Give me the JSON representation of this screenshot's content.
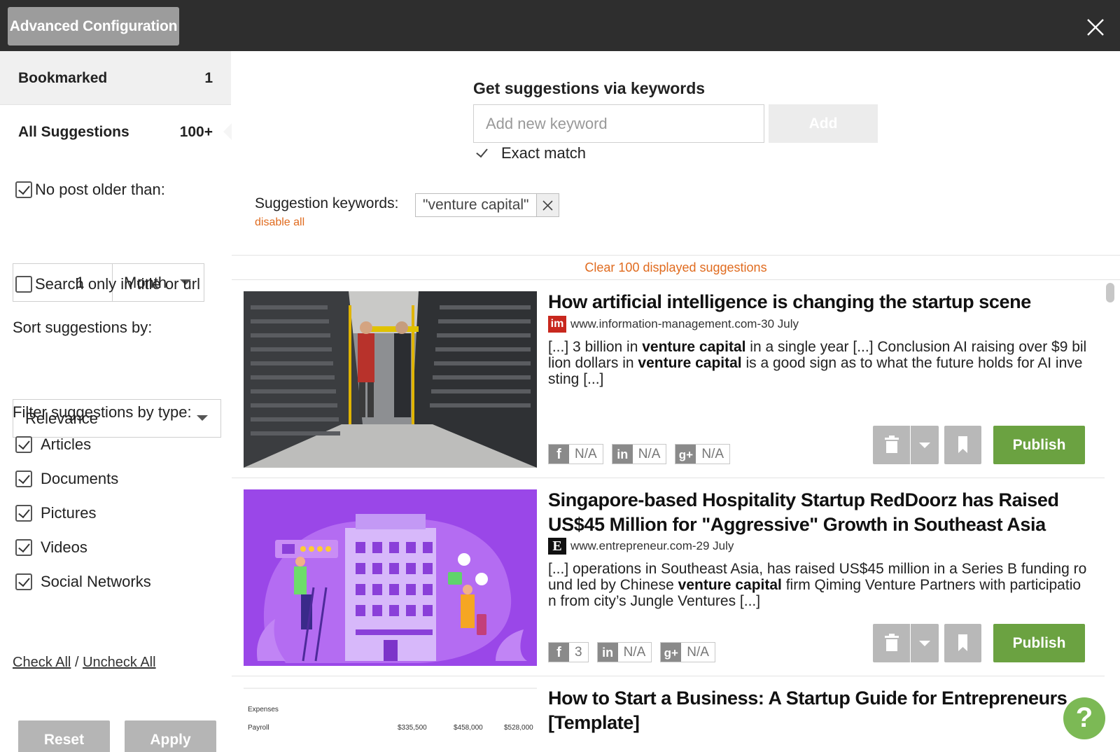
{
  "header": {
    "title": "Advanced Configuration"
  },
  "sidebar": {
    "bookmarked": {
      "label": "Bookmarked",
      "count": "1"
    },
    "all": {
      "label": "All Suggestions",
      "count": "100+"
    },
    "age_filter": {
      "label": "No post older than:",
      "checked": true,
      "amount": "1",
      "unit": "Month"
    },
    "title_only": {
      "label": "Search only in title or url",
      "checked": false
    },
    "sort": {
      "label": "Sort suggestions by:",
      "value": "Relevance"
    },
    "type_filter": {
      "label": "Filter suggestions by type:",
      "types": [
        {
          "label": "Articles",
          "checked": true
        },
        {
          "label": "Documents",
          "checked": true
        },
        {
          "label": "Pictures",
          "checked": true
        },
        {
          "label": "Videos",
          "checked": true
        },
        {
          "label": "Social Networks",
          "checked": true
        }
      ]
    },
    "check_all": "Check All",
    "separator": "/",
    "uncheck_all": "Uncheck All",
    "reset": "Reset",
    "apply": "Apply"
  },
  "keywords": {
    "title": "Get suggestions via keywords",
    "placeholder": "Add new keyword",
    "add": "Add",
    "exact_match": "Exact match",
    "list_label": "Suggestion keywords:",
    "disable_all": "disable all",
    "tags": [
      "\"venture capital\""
    ]
  },
  "clear_label": "Clear 100 displayed suggestions",
  "suggestions": [
    {
      "title": "How artificial intelligence is changing the startup scene",
      "source": "www.information-management.com",
      "date": "30 July",
      "logo": "im",
      "snippet_parts": [
        "[...] 3 billion in ",
        "venture capital",
        " in a single year [...] Conclusion AI raising over $9 billion dollars in ",
        "venture capital",
        " is a good sign as to what the future holds for AI investing [...]"
      ],
      "shares": {
        "facebook": "N/A",
        "linkedin": "N/A",
        "google": "N/A"
      },
      "publish": "Publish"
    },
    {
      "title": "Singapore-based Hospitality Startup RedDoorz has Raised US$45 Million for \"Aggressive\" Growth in Southeast Asia",
      "source": "www.entrepreneur.com",
      "date": "29 July",
      "logo": "E",
      "snippet_parts": [
        "[...] operations in Southeast Asia, has raised US$45 million in a Series B funding round led by Chinese ",
        "venture capital",
        " firm Qiming Venture Partners with participation from city’s Jungle Ventures [...]"
      ],
      "shares": {
        "facebook": "3",
        "linkedin": "N/A",
        "google": "N/A"
      },
      "publish": "Publish"
    },
    {
      "title": "How to Start a Business: A Startup Guide for Entrepreneurs [Template]",
      "thumb_rows": [
        {
          "label": "Expenses",
          "values": [
            "",
            "",
            ""
          ]
        },
        {
          "label": "Payroll",
          "values": [
            "$335,500",
            "$458,000",
            "$528,000"
          ]
        }
      ]
    }
  ],
  "share_icons": {
    "facebook": "f",
    "linkedin": "in",
    "google": "g+"
  },
  "separator_dash": " - ",
  "help_label": "?",
  "colors": {
    "accent": "#e06b1f",
    "publish": "#6ba241",
    "topbar": "#2e2e2e"
  }
}
